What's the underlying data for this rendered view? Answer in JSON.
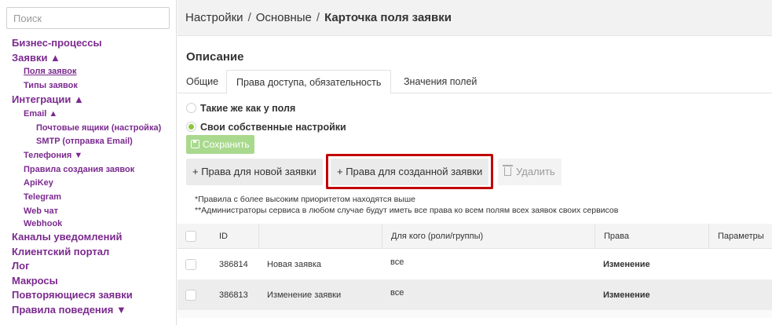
{
  "sidebar": {
    "search_placeholder": "Поиск",
    "items": [
      {
        "label": "Бизнес-процессы"
      },
      {
        "label": "Заявки ▲"
      },
      {
        "label": "Поля заявок"
      },
      {
        "label": "Типы заявок"
      },
      {
        "label": "Интеграции ▲"
      },
      {
        "label": "Email ▲"
      },
      {
        "label": "Почтовые ящики (настройка)"
      },
      {
        "label": "SMTP (отправка Email)"
      },
      {
        "label": "Телефония ▼"
      },
      {
        "label": "Правила создания заявок"
      },
      {
        "label": "ApiKey"
      },
      {
        "label": "Telegram"
      },
      {
        "label": "Web чат"
      },
      {
        "label": "Webhook"
      },
      {
        "label": "Каналы уведомлений"
      },
      {
        "label": "Клиентский портал"
      },
      {
        "label": "Лог"
      },
      {
        "label": "Макросы"
      },
      {
        "label": "Повторяющиеся заявки"
      },
      {
        "label": "Правила поведения ▼"
      }
    ]
  },
  "breadcrumb": {
    "item1": "Настройки",
    "sep": "/",
    "item2": "Основные",
    "current": "Карточка поля заявки"
  },
  "section_title": "Описание",
  "tabs": [
    "Общие",
    "Права доступа, обязательность",
    "Значения полей"
  ],
  "radios": {
    "same_as_field": "Такие же как у поля",
    "own_settings": "Свои собственные настройки",
    "selected": "own_settings"
  },
  "buttons": {
    "save": "Сохранить",
    "rights_new": "+ Права для новой заявки",
    "rights_created": "+ Права для созданной заявки",
    "delete": "Удалить"
  },
  "notes": [
    "*Правила с более высоким приоритетом находятся выше",
    "**Администраторы сервиса в любом случае будут иметь все права ко всем полям всех заявок своих сервисов"
  ],
  "table": {
    "headers": [
      "ID",
      "",
      "Для кого (роли/группы)",
      "Права",
      "Параметры"
    ],
    "rows": [
      {
        "id": "386814",
        "name": "Новая заявка",
        "for_whom": "все",
        "rights": "Изменение"
      },
      {
        "id": "386813",
        "name": "Изменение заявки",
        "for_whom": "все",
        "rights": "Изменение"
      }
    ]
  },
  "colors": {
    "link": "#7b2a8f",
    "highlight_border": "#c00000",
    "radio_on": "#8cc63f",
    "save_button": "#a9d98d"
  }
}
